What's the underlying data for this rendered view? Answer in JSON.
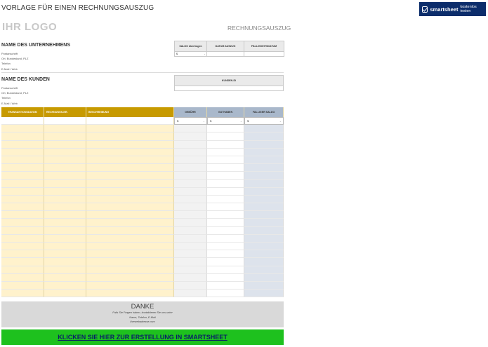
{
  "page": {
    "title": "VORLAGE FÜR EINEN RECHNUNGSAUSZUG",
    "brand": {
      "name": "smartsheet",
      "tagline": "kostenlos testen"
    },
    "logo": "IHR LOGO",
    "doc_title": "RECHNUNGSAUSZUG"
  },
  "company": {
    "heading": "NAME DES UNTERNEHMENS",
    "lines": [
      "Postanschrift",
      "Ort, Bundesland, PLZ",
      "Telefon",
      "E-Mail / Web"
    ]
  },
  "customer": {
    "heading": "NAME DES KUNDEN",
    "lines": [
      "Postanschrift",
      "Ort, Bundesland, PLZ",
      "Telefon",
      "E-Mail / Web"
    ]
  },
  "summary": {
    "headers": [
      "SALDO übertragen",
      "DATUM AUSZUG",
      "FÄLLIGKEITSDATUM"
    ],
    "currency": "$",
    "dash": "-"
  },
  "customer_id": {
    "header": "KUNDEN-ID"
  },
  "ledger": {
    "headers": [
      "TRANSAKTIONSDATUM",
      "RECHNUNGS-NR.",
      "BESCHREIBUNG",
      "GEBÜHR",
      "GUTHABEN",
      "FÄLLIGER SALDO"
    ],
    "currency": "$",
    "dash": "-",
    "empty_rows": 22
  },
  "thanks": {
    "title": "DANKE",
    "line1": "Falls Sie Fragen haben, kontaktieren Sie uns unter",
    "line2": "Name, Telefon, E-Mail",
    "line3": "Ihrewebadresse.com"
  },
  "cta": {
    "label": "KLICKEN SIE HIER ZUR ERSTELLUNG IN SMARTSHEET",
    "color": "#1ec11e"
  }
}
